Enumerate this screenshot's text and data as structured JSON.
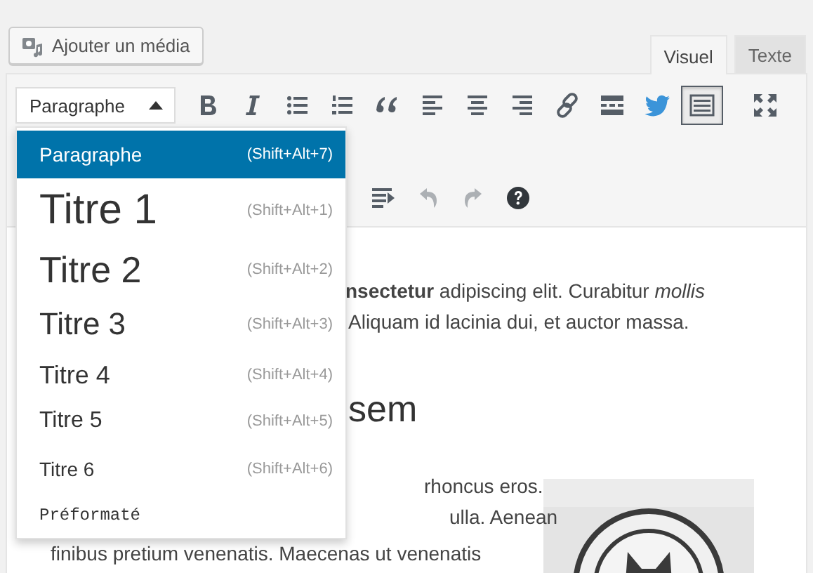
{
  "media_button": {
    "label": "Ajouter un média"
  },
  "tabs": [
    {
      "label": "Visuel",
      "selected": true
    },
    {
      "label": "Texte",
      "selected": false
    }
  ],
  "format_select": {
    "value": "Paragraphe",
    "open": true
  },
  "toolbar": [
    {
      "kind": "bold",
      "pressed": false
    },
    {
      "kind": "italic",
      "pressed": false
    },
    {
      "kind": "bullet-list",
      "pressed": false
    },
    {
      "kind": "numbered-list",
      "pressed": false
    },
    {
      "kind": "quote",
      "pressed": false
    },
    {
      "kind": "align-left",
      "pressed": false
    },
    {
      "kind": "align-center",
      "pressed": false
    },
    {
      "kind": "align-right",
      "pressed": false
    },
    {
      "kind": "link",
      "pressed": false
    },
    {
      "kind": "read-more",
      "pressed": false
    },
    {
      "kind": "bird",
      "pressed": false
    },
    {
      "kind": "toolbar-toggle",
      "pressed": true
    },
    {
      "kind": "fullscreen",
      "pressed": false
    }
  ],
  "toolbar_row_2": [
    {
      "kind": "wrap",
      "disabled": false
    },
    {
      "kind": "undo",
      "disabled": true
    },
    {
      "kind": "redo",
      "disabled": true
    },
    {
      "kind": "help",
      "disabled": false
    }
  ],
  "format_menu": [
    {
      "kind": "p",
      "label": "Paragraphe",
      "shortcut": "(Shift+Alt+7)",
      "selected": true
    },
    {
      "kind": "h1",
      "label": "Titre 1",
      "shortcut": "(Shift+Alt+1)",
      "selected": false
    },
    {
      "kind": "h2",
      "label": "Titre 2",
      "shortcut": "(Shift+Alt+2)",
      "selected": false
    },
    {
      "kind": "h3",
      "label": "Titre 3",
      "shortcut": "(Shift+Alt+3)",
      "selected": false
    },
    {
      "kind": "h4",
      "label": "Titre 4",
      "shortcut": "(Shift+Alt+4)",
      "selected": false
    },
    {
      "kind": "h5",
      "label": "Titre 5",
      "shortcut": "(Shift+Alt+5)",
      "selected": false
    },
    {
      "kind": "h6",
      "label": "Titre 6",
      "shortcut": "(Shift+Alt+6)",
      "selected": false
    },
    {
      "kind": "pre",
      "label": "Préformaté",
      "selected": false
    }
  ],
  "content": {
    "paragraph_1": [
      "**nsectetur** adipiscing elit. Curabitur *mollis*",
      "Aliquam id lacinia dui, et auctor massa."
    ],
    "heading": "sem",
    "paragraph_2": [
      "rhoncus eros.",
      "ulla. Aenean",
      "finibus pretium venenatis. Maecenas ut venenatis"
    ],
    "image": {
      "kind": "picture"
    }
  }
}
